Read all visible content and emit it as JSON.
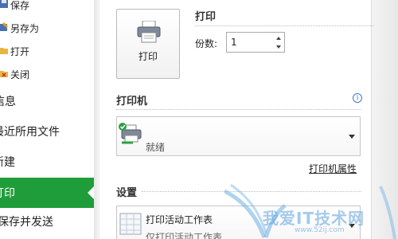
{
  "sidebar": {
    "items": [
      {
        "label": "保存"
      },
      {
        "label": "另存为"
      },
      {
        "label": "打开"
      },
      {
        "label": "关闭"
      },
      {
        "label": "信息"
      },
      {
        "label": "最近所用文件"
      },
      {
        "label": "新建"
      },
      {
        "label": "打印"
      },
      {
        "label": "保存并发送"
      }
    ],
    "active_color": "#1f9d3a"
  },
  "print": {
    "section_title": "打印",
    "button_label": "打印",
    "copies_label": "份数:",
    "copies_value": "1"
  },
  "printer": {
    "section_title": "打印机",
    "name": "",
    "status": "就绪",
    "properties_link": "打印机属性"
  },
  "settings": {
    "section_title": "设置",
    "option_title": "打印活动工作表",
    "option_desc": "仅打印活动工作表"
  },
  "watermark": {
    "text": "我爱IT技术网",
    "sub": "www.52ij.com"
  },
  "icons": {
    "save": "save-icon",
    "save_as": "save-as-icon",
    "open": "open-folder-icon",
    "close": "close-icon",
    "printer": "printer-icon",
    "info": "info-icon",
    "sheet": "worksheet-icon"
  }
}
